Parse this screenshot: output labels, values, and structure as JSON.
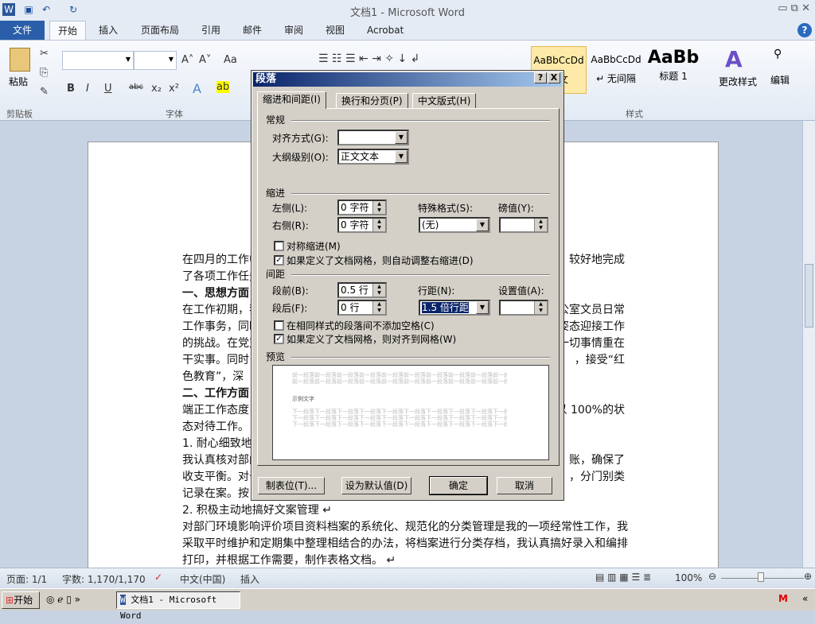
{
  "window": {
    "title": "文档1 - Microsoft Word"
  },
  "ribbon_tabs": [
    "文件",
    "开始",
    "插入",
    "页面布局",
    "引用",
    "邮件",
    "审阅",
    "视图",
    "Acrobat"
  ],
  "ribbon": {
    "paste": "粘贴",
    "clipboard_group": "剪贴板",
    "font_group": "字体",
    "styles_group": "样式",
    "styles": [
      {
        "preview": "AaBbCcDd",
        "name": "正文"
      },
      {
        "preview": "AaBbCcDd",
        "name": "↵ 无间隔"
      },
      {
        "preview": "AaBb",
        "name": "标题 1"
      }
    ],
    "change_styles": "更改样式",
    "editing": "编辑",
    "font_buttons": [
      "B",
      "I",
      "U",
      "abc",
      "x₂",
      "x²"
    ],
    "size_buttons": [
      "A˄",
      "A˅",
      "Aa"
    ]
  },
  "document": {
    "lines": [
      {
        "l": "在四月的工作中",
        "r": "较好地完成"
      },
      {
        "l": "了各项工作任务",
        "r": ""
      },
      {
        "l": "一、思想方面",
        "r": "",
        "bold": true
      },
      {
        "l": "在工作初期，我",
        "r": "公室文员日常"
      },
      {
        "l": "工作事务，同时",
        "r": "姿态迎接工作"
      },
      {
        "l": "的挑战。在党支",
        "r": "一切事情重在"
      },
      {
        "l": "干实事。同时",
        "r": "，接受“红"
      },
      {
        "l": "色教育”，深",
        "r": ""
      },
      {
        "l": "二、工作方面",
        "r": "",
        "bold": true
      },
      {
        "l": "端正工作态度，",
        "r": "以 100%的状"
      },
      {
        "l": "态对待工作。",
        "r": ""
      },
      {
        "l": "1. 耐心细致地",
        "r": ""
      },
      {
        "l": "我认真核对部门",
        "r": "账，确保了"
      },
      {
        "l": "收支平衡。对于",
        "r": "，分门别类"
      },
      {
        "l": "记录在案。按",
        "r": ""
      },
      {
        "l": "2. 积极主动地搞好文案管理 ↵",
        "r": ""
      },
      {
        "l": "对部门环境影响评价项目资料档案的系统化、规范化的分类管理是我的一项经常性工作，我",
        "r": ""
      },
      {
        "l": "采取平时维护和定期集中整理相结合的办法，将档案进行分类存档，我认真搞好录入和编排",
        "r": ""
      },
      {
        "l": "打印，并根据工作需要，制作表格文档。 ↵",
        "r": ""
      }
    ]
  },
  "dialog": {
    "title": "段落",
    "help": "?",
    "close": "X",
    "tabs": [
      "缩进和间距(I)",
      "换行和分页(P)",
      "中文版式(H)"
    ],
    "general": "常规",
    "alignment_label": "对齐方式(G):",
    "alignment_value": "",
    "outline_label": "大纲级别(O):",
    "outline_value": "正文文本",
    "indent": "缩进",
    "left_label": "左侧(L):",
    "left_value": "0 字符",
    "right_label": "右侧(R):",
    "right_value": "0 字符",
    "special_label": "特殊格式(S):",
    "special_value": "(无)",
    "by_label": "磅值(Y):",
    "by_value": "",
    "mirror": "对称缩进(M)",
    "mirror_checked": false,
    "auto_right": "如果定义了文档网格，则自动调整右缩进(D)",
    "auto_right_checked": true,
    "spacing": "间距",
    "before_label": "段前(B):",
    "before_value": "0.5 行",
    "after_label": "段后(F):",
    "after_value": "0 行",
    "line_label": "行距(N):",
    "line_value": "1.5 倍行距",
    "at_label": "设置值(A):",
    "at_value": "",
    "no_space": "在相同样式的段落间不添加空格(C)",
    "no_space_checked": false,
    "snap_grid": "如果定义了文档网格，则对齐到网格(W)",
    "snap_grid_checked": true,
    "preview": "预览",
    "preview_prev": "前一段落前一段落前一段落前一段落前一段落前一段落前一段落前一段落前一段落前一段落",
    "preview_sample": "示例文字",
    "preview_next": "下一段落下一段落下一段落下一段落下一段落下一段落下一段落下一段落下一段落下一段落",
    "tabs_button": "制表位(T)...",
    "default_button": "设为默认值(D)",
    "ok": "确定",
    "cancel": "取消"
  },
  "status": {
    "page": "页面: 1/1",
    "words": "字数: 1,170/1,170",
    "lang": "中文(中国)",
    "mode": "插入",
    "zoom": "100%",
    "zoom_level": 100
  },
  "taskbar": {
    "start": "开始",
    "task": "文档1 - Microsoft Word"
  }
}
